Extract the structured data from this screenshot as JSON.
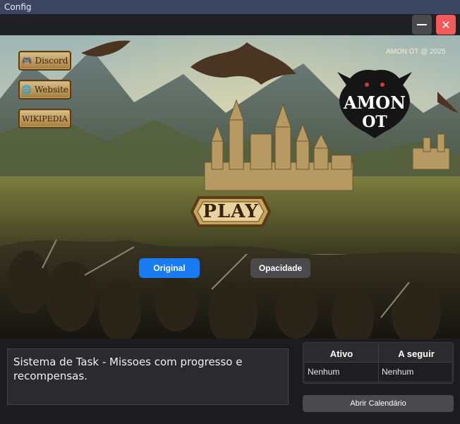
{
  "window": {
    "title": "Config",
    "minimize_label": "",
    "close_label": "✕"
  },
  "links": [
    {
      "label": "Discord",
      "icon": "discord-icon",
      "glyph": "🎮"
    },
    {
      "label": "Website",
      "icon": "globe-icon",
      "glyph": "🌐"
    },
    {
      "label": "WIKIPEDIA",
      "icon": "",
      "glyph": ""
    }
  ],
  "banner": {
    "copyright": "AMON OT @ 2025",
    "logo_line1": "AMON",
    "logo_line2": "OT"
  },
  "play_label": "PLAY",
  "modes": {
    "original": "Original",
    "opacity": "Opacidade",
    "active": "original"
  },
  "task": {
    "text": "Sistema de Task - Missoes com progresso e recompensas."
  },
  "schedule": {
    "headers": [
      "Ativo",
      "A seguir"
    ],
    "row": [
      "Nenhum",
      "Nenhum"
    ]
  },
  "calendar_button": "Abrir Calendário",
  "colors": {
    "accent": "#1a7cf5",
    "close": "#f05a5a",
    "titlebar": "#3d4660"
  }
}
